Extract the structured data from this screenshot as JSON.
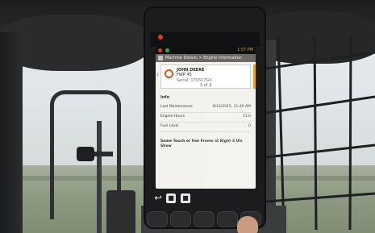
{
  "device": {
    "status_time": "1:57 PM",
    "header_title": "Machine Details > Engine Information",
    "card": {
      "line1": "JOHN DEERE",
      "line2": "FWP 45",
      "line3": "Serial: 1T0317GX",
      "line4": "1 of 3"
    },
    "info_heading": "Info",
    "rows": [
      {
        "key": "Last Maintenance",
        "value": "8/12/2015, 11:49 AM"
      },
      {
        "key": "Engine Hours",
        "value": "11.0"
      },
      {
        "key": "Fuel Level",
        "value": "0"
      }
    ],
    "note": "Some Touch or Use Frame at Right 3 Uls Show",
    "softkeys": {
      "back": "↩",
      "a": "■",
      "b": "■"
    }
  },
  "colors": {
    "accent": "#d8570f",
    "screen_background": "#f3f2ee",
    "side_tab": "#e4a017",
    "status_led": "#e23b2e"
  }
}
